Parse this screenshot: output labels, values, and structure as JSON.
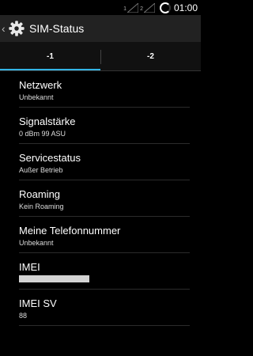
{
  "statusbar": {
    "sim1": "1",
    "sim2": "2",
    "time": "01:00"
  },
  "actionbar": {
    "title": "SIM-Status"
  },
  "tabs": [
    {
      "label": "-1",
      "active": true
    },
    {
      "label": "-2",
      "active": false
    }
  ],
  "items": [
    {
      "label": "Netzwerk",
      "value": "Unbekannt"
    },
    {
      "label": "Signalstärke",
      "value": "0 dBm   99 ASU"
    },
    {
      "label": "Servicestatus",
      "value": "Außer Betrieb"
    },
    {
      "label": "Roaming",
      "value": "Kein Roaming"
    },
    {
      "label": "Meine Telefonnummer",
      "value": "Unbekannt"
    },
    {
      "label": "IMEI",
      "value": "",
      "redacted": true
    },
    {
      "label": "IMEI SV",
      "value": "88"
    }
  ],
  "colors": {
    "accent": "#33b5e5",
    "actionbar": "#222222"
  },
  "icons": {
    "back": "chevron-left-icon",
    "settings": "gear-icon",
    "signal": "signal-icon",
    "loading": "spinner-icon"
  }
}
